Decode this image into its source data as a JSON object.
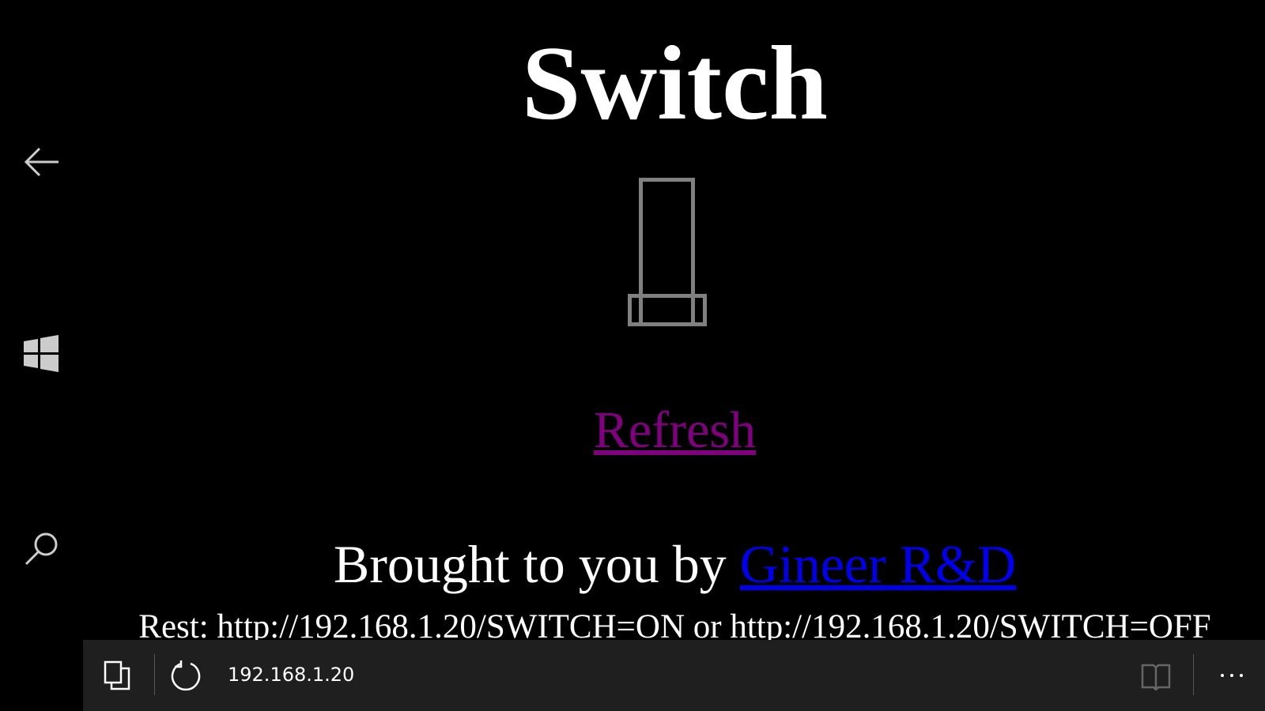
{
  "page": {
    "title": "Switch",
    "switch_state_icon": "switch-off-icon",
    "refresh_label": "Refresh",
    "credit_prefix": "Brought to you by ",
    "credit_link": "Gineer R&D",
    "rest_text": "Rest: http://192.168.1.20/SWITCH=ON or http://192.168.1.20/SWITCH=OFF",
    "colors": {
      "visited_link": "#800080",
      "link": "#0000ee",
      "switch": "#808080"
    }
  },
  "sidebar": {
    "icons": [
      "back-arrow-icon",
      "windows-start-icon",
      "search-icon"
    ]
  },
  "browser_bar": {
    "address": "192.168.1.20",
    "icons": [
      "tabs-icon",
      "refresh-icon",
      "reading-view-icon",
      "more-icon"
    ]
  }
}
